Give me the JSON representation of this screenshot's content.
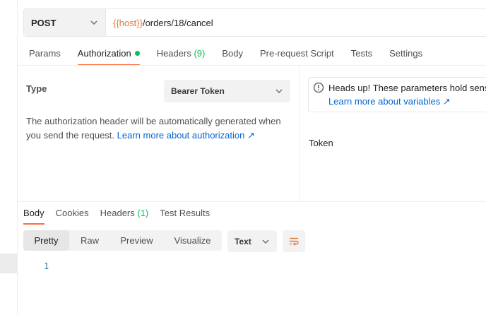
{
  "request": {
    "method": "POST",
    "url_var": "{{host}}",
    "url_path": "/orders/18/cancel"
  },
  "request_tabs": [
    {
      "label": "Params",
      "count": "",
      "active": false
    },
    {
      "label": "Authorization",
      "count": "",
      "active": true,
      "indicator": "green-dot"
    },
    {
      "label": "Headers",
      "count": "(9)",
      "active": false
    },
    {
      "label": "Body",
      "count": "",
      "active": false
    },
    {
      "label": "Pre-request Script",
      "count": "",
      "active": false
    },
    {
      "label": "Tests",
      "count": "",
      "active": false
    },
    {
      "label": "Settings",
      "count": "",
      "active": false
    }
  ],
  "auth": {
    "type_label": "Type",
    "type_value": "Bearer Token",
    "description": "The authorization header will be automatically generated when you send the request.",
    "learn_link": "Learn more about authorization ↗",
    "notice_title": "Heads up! These parameters hold sensi",
    "notice_link": "Learn more about variables ↗",
    "token_label": "Token"
  },
  "response_tabs": [
    {
      "label": "Body",
      "count": "",
      "active": true
    },
    {
      "label": "Cookies",
      "count": "",
      "active": false
    },
    {
      "label": "Headers",
      "count": "(1)",
      "active": false
    },
    {
      "label": "Test Results",
      "count": "",
      "active": false
    }
  ],
  "response_view": {
    "modes": [
      "Pretty",
      "Raw",
      "Preview",
      "Visualize"
    ],
    "active_mode": "Pretty",
    "format": "Text",
    "wrap_icon": "wrap-lines-icon",
    "line_number": "1"
  },
  "colors": {
    "accent": "#ff6c37",
    "variable": "#e1783b",
    "link": "#0265d2",
    "status_green": "#0cbb52"
  }
}
